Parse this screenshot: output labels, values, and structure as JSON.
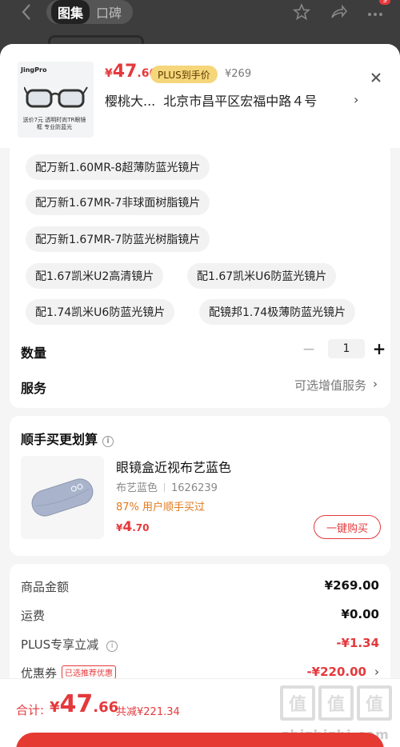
{
  "topnav": {
    "tabs": [
      {
        "label": "图集"
      },
      {
        "label": "口碑"
      }
    ],
    "badge": "9"
  },
  "header": {
    "thumb_brand": "JingPro",
    "thumb_tag": "送价7元 透明时尚TR眼镜框 专业防蓝光",
    "price_symbol": "¥",
    "price_int": "47",
    "price_dec": ".66",
    "plus_badge": "PLUS到手价",
    "original_price": "¥269",
    "recipient": "樱桃大...",
    "address": "北京市昌平区宏福中路４号"
  },
  "options": {
    "chips": [
      {
        "label": "配万新1.60MR-8超薄防蓝光镜片"
      },
      {
        "label": "配万新1.67MR-7非球面树脂镜片"
      },
      {
        "label": "配万新1.67MR-7防蓝光树脂镜片"
      },
      {
        "label": "配1.67凯米U2高清镜片"
      },
      {
        "label": "配1.67凯米U6防蓝光镜片"
      },
      {
        "label": "配1.74凯米U6防蓝光镜片"
      },
      {
        "label": "配镜邦1.74极薄防蓝光镜片"
      }
    ],
    "quantity_label": "数量",
    "quantity": "1",
    "service_label": "服务",
    "service_value": "可选增值服务"
  },
  "addon": {
    "title": "顺手买更划算",
    "name": "眼镜盒近视布艺蓝色",
    "spec": "布艺蓝色",
    "sku": "1626239",
    "bought": "87% 用户顺手买过",
    "price_symbol": "¥",
    "price_int": "4",
    "price_dec": ".70",
    "buy_label": "一键购买"
  },
  "summary": {
    "rows": [
      {
        "label": "商品金额",
        "value": "¥269.00"
      },
      {
        "label": "运费",
        "value": "¥0.00"
      },
      {
        "label": "PLUS专享立减",
        "value": "-¥1.34"
      },
      {
        "label": "优惠券",
        "value": "-¥220.00"
      }
    ],
    "coupon_tag": "已选推荐优惠"
  },
  "footer": {
    "total_label": "合计:",
    "total_symbol": "¥",
    "total_int": "47",
    "total_dec": ".66",
    "saving": "共减¥221.34",
    "watermark": "值",
    "watermark_url": "zhizhizhi.com"
  },
  "colors": {
    "accent": "#e4393c",
    "plus_gold": "#f5d67a"
  }
}
